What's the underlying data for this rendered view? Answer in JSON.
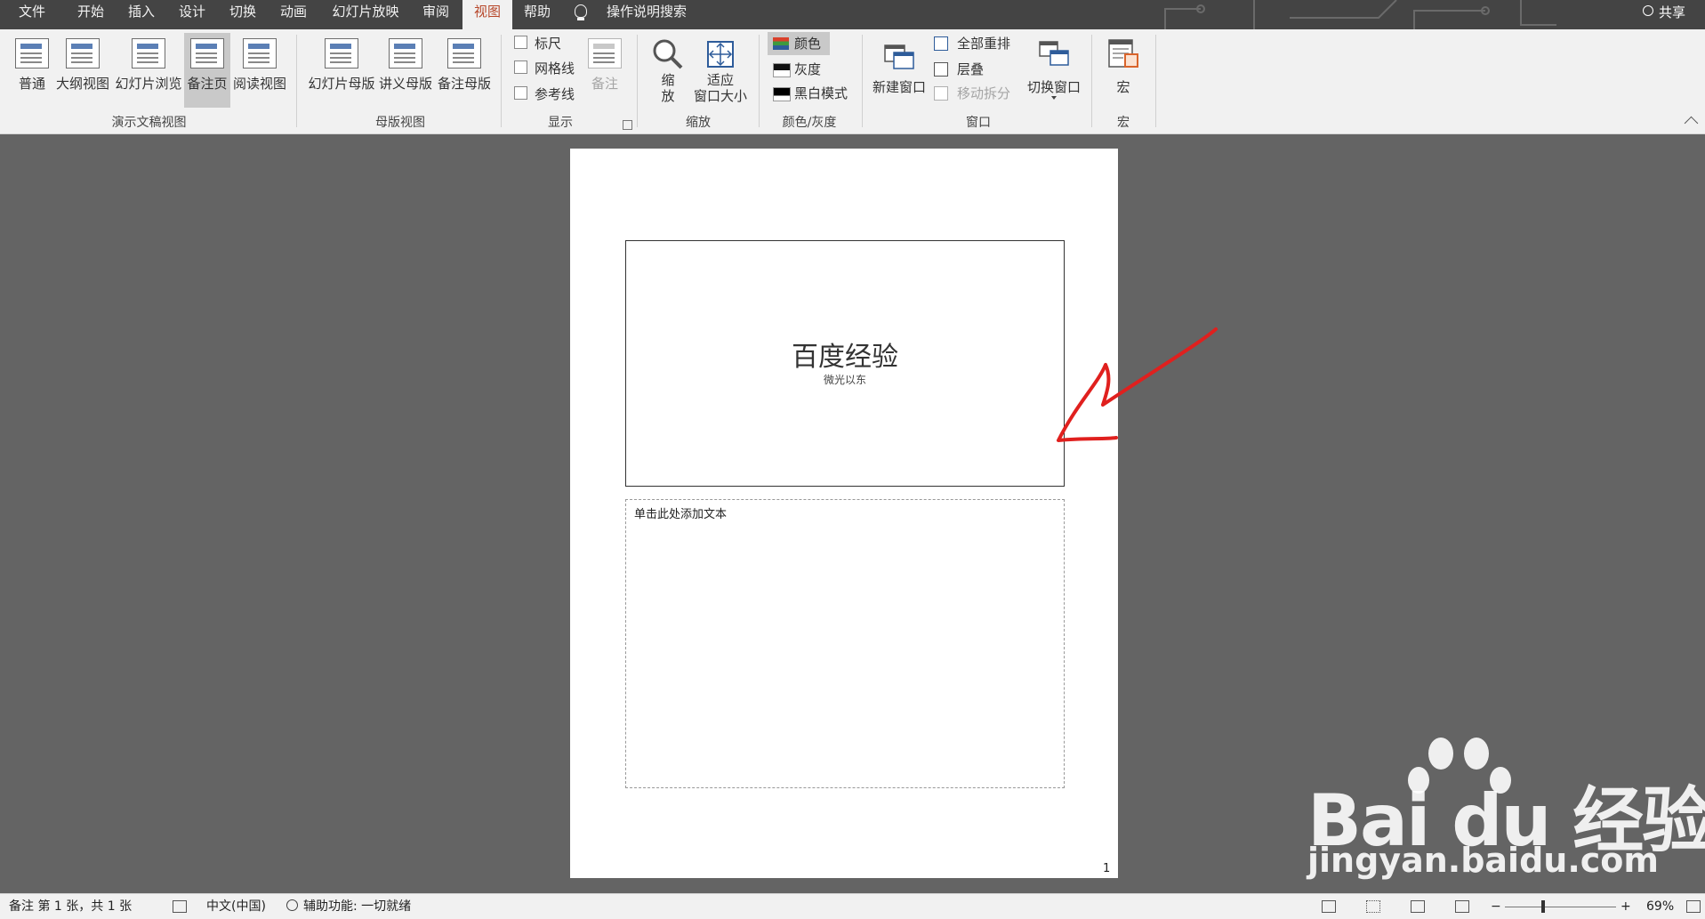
{
  "tabs": [
    {
      "label": "文件"
    },
    {
      "label": "开始"
    },
    {
      "label": "插入"
    },
    {
      "label": "设计"
    },
    {
      "label": "切换"
    },
    {
      "label": "动画"
    },
    {
      "label": "幻灯片放映"
    },
    {
      "label": "审阅"
    },
    {
      "label": "视图",
      "active": true
    },
    {
      "label": "帮助"
    }
  ],
  "tell_me": "操作说明搜索",
  "share": "共享",
  "ribbon": {
    "presentation_views": {
      "group_label": "演示文稿视图",
      "buttons": [
        "普通",
        "大纲视图",
        "幻灯片浏览",
        "备注页",
        "阅读视图"
      ],
      "pressed": "备注页"
    },
    "master_views": {
      "group_label": "母版视图",
      "buttons": [
        "幻灯片母版",
        "讲义母版",
        "备注母版"
      ]
    },
    "show": {
      "group_label": "显示",
      "checkboxes": [
        "标尺",
        "网格线",
        "参考线"
      ],
      "notes_button": "备注"
    },
    "zoom": {
      "group_label": "缩放",
      "zoom_button_line1": "缩",
      "zoom_button_line2": "放",
      "fit_button_line1": "适应",
      "fit_button_line2": "窗口大小"
    },
    "color_grayscale": {
      "group_label": "颜色/灰度",
      "buttons": [
        "颜色",
        "灰度",
        "黑白模式"
      ],
      "pressed": "颜色"
    },
    "window": {
      "group_label": "窗口",
      "new_window": "新建窗口",
      "arrange_all": "全部重排",
      "cascade": "层叠",
      "move_split": "移动拆分",
      "switch_windows": "切换窗口"
    },
    "macros": {
      "group_label": "宏",
      "button": "宏"
    }
  },
  "page": {
    "slide_title": "百度经验",
    "slide_subtitle": "微光以东",
    "notes_placeholder": "单击此处添加文本",
    "page_number": "1"
  },
  "status_bar": {
    "slide_info": "备注 第 1 张，共 1 张",
    "language": "中文(中国)",
    "accessibility": "辅助功能: 一切就绪",
    "zoom_minus": "−",
    "zoom_plus": "+",
    "zoom_level": "69%"
  },
  "watermark": {
    "logo_text": "Bai du 经验",
    "url": "jingyan.baidu.com"
  },
  "colors": {
    "tabbar_bg": "#444444",
    "active_tab_text": "#b7472a",
    "ribbon_bg": "#f1f1f1",
    "workspace_bg": "#646464",
    "annotation_arrow": "#e0201e"
  }
}
